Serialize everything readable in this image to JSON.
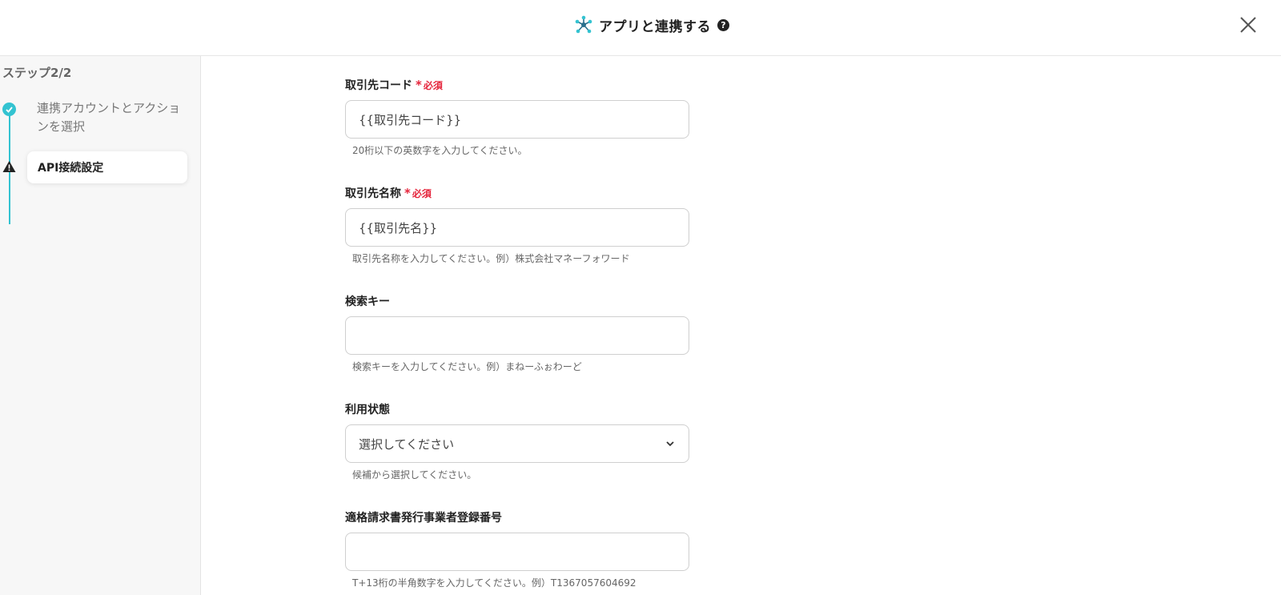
{
  "header": {
    "title": "アプリと連携する",
    "help_icon": "?",
    "app_icon": "network-nodes-icon",
    "close_icon": "close-icon"
  },
  "sidebar": {
    "step_label": "ステップ2/2",
    "steps": [
      {
        "label": "連携アカウントとアクションを選択",
        "status": "completed",
        "icon": "check-circle-icon"
      },
      {
        "label": "API接続設定",
        "status": "warning",
        "icon": "warning-triangle-icon"
      }
    ]
  },
  "form": {
    "fields": [
      {
        "label": "取引先コード",
        "required": true,
        "required_mark": "*",
        "required_text": "必須",
        "value": "{{取引先コード}}",
        "help": "20桁以下の英数字を入力してください。"
      },
      {
        "label": "取引先名称",
        "required": true,
        "required_mark": "*",
        "required_text": "必須",
        "value": "{{取引先名}}",
        "help": "取引先名称を入力してください。例）株式会社マネーフォワード"
      },
      {
        "label": "検索キー",
        "required": false,
        "value": "",
        "help": "検索キーを入力してください。例）まねーふぉわーど"
      },
      {
        "label": "利用状態",
        "required": false,
        "type": "select",
        "value": "選択してください",
        "help": "候補から選択してください。"
      },
      {
        "label": "適格請求書発行事業者登録番号",
        "required": false,
        "value": "",
        "help": "T+13桁の半角数字を入力してください。例）T1367057604692"
      }
    ]
  },
  "colors": {
    "accent": "#33c3d1",
    "required": "#e5243b",
    "sidebar_bg": "#f7f7f7"
  }
}
